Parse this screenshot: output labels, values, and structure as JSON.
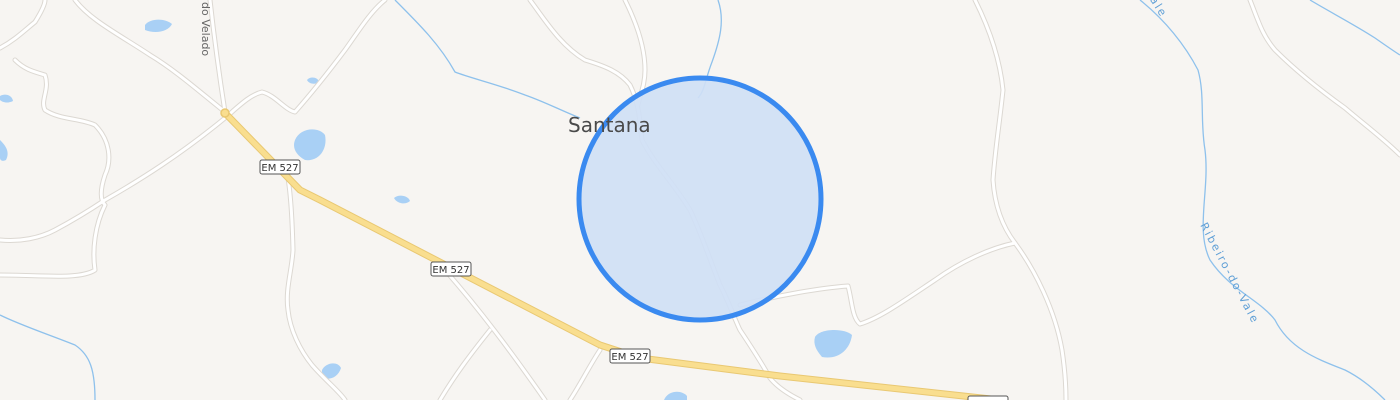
{
  "map": {
    "place": "Santana",
    "road_labels": [
      "EM 527",
      "EM 527",
      "EM 527"
    ],
    "street_label": "do Velado",
    "water_labels": [
      "Ribeiro-do-Vale",
      "Vale"
    ],
    "location_circle": {
      "fill": "#cfdff5",
      "stroke": "#3a8af0"
    },
    "colors": {
      "background": "#f7f5f2",
      "water": "#a9d0f5",
      "stream": "#8ec1ec",
      "road_fill": "#f9de8f",
      "road_casing": "#e9c872",
      "minor_road": "#ffffff",
      "minor_road_casing": "#dcd8d2"
    }
  }
}
